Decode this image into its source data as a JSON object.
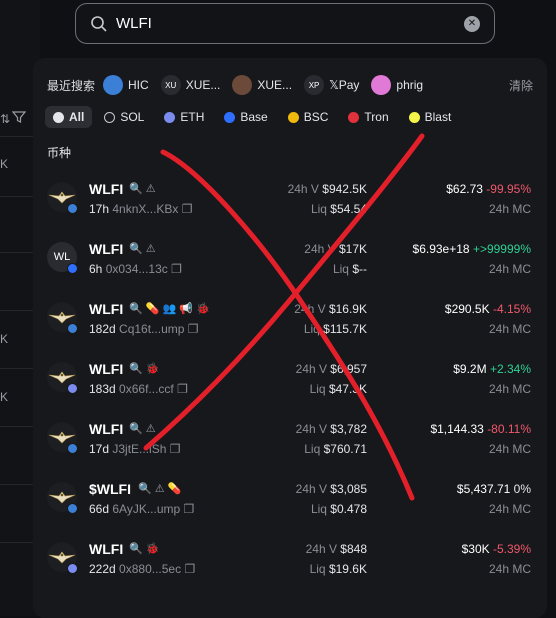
{
  "search": {
    "value": "WLFI",
    "placeholder": ""
  },
  "bg_left": {
    "k_labels": [
      "K",
      "K",
      "K"
    ]
  },
  "recent": {
    "label": "最近搜索",
    "clear_label": "清除",
    "items": [
      {
        "label": "HIC",
        "avatar_text": "",
        "color": "#3b7fd6"
      },
      {
        "label": "XUE...",
        "avatar_text": "XU",
        "color": "#2a2b31"
      },
      {
        "label": "XUE...",
        "avatar_text": "",
        "color": "#6b4a3a"
      },
      {
        "label": "𝕏Pay",
        "avatar_text": "XP",
        "color": "#2a2b31"
      },
      {
        "label": "phrig",
        "avatar_text": "",
        "color": "#e07ad6"
      }
    ]
  },
  "chains": [
    {
      "label": "All",
      "color": "#e6e6ea",
      "active": true
    },
    {
      "label": "SOL",
      "color": "#1a1b20",
      "active": false
    },
    {
      "label": "ETH",
      "color": "#7b8cf0",
      "active": false
    },
    {
      "label": "Base",
      "color": "#2f6fff",
      "active": false
    },
    {
      "label": "BSC",
      "color": "#f0b90b",
      "active": false
    },
    {
      "label": "Tron",
      "color": "#e0313c",
      "active": false
    },
    {
      "label": "Blast",
      "color": "#f3f34a",
      "active": false
    }
  ],
  "section_title": "币种",
  "tokens": [
    {
      "name": "WLFI",
      "logo": "eagle",
      "logo_text": "",
      "chain_color": "#3b7fd6",
      "icons": "🔍 ⚠",
      "age": "17h",
      "addr": "4nknX...KBx",
      "v_label": "24h V",
      "volume": "$942.5K",
      "liq_label": "Liq",
      "liq": "$54.54",
      "price": "$62.73",
      "change": "-99.95%",
      "change_kind": "neg",
      "mc_label": "24h MC"
    },
    {
      "name": "WLFI",
      "logo": "wl",
      "logo_text": "WL",
      "chain_color": "#2f6fff",
      "icons": "🔍 ⚠",
      "age": "6h",
      "addr": "0x034...13c",
      "v_label": "24h V",
      "volume": "$17K",
      "liq_label": "Liq",
      "liq": "$--",
      "price": "$6.93e+18",
      "change": "+>99999%",
      "change_kind": "pos",
      "mc_label": "24h MC"
    },
    {
      "name": "WLFI",
      "logo": "eagle",
      "logo_text": "",
      "chain_color": "#3b7fd6",
      "icons": "🔍 💊 👥 📢 🐞",
      "age": "182d",
      "addr": "Cq16t...ump",
      "v_label": "24h V",
      "volume": "$16.9K",
      "liq_label": "Liq",
      "liq": "$115.7K",
      "price": "$290.5K",
      "change": "-4.15%",
      "change_kind": "neg",
      "mc_label": "24h MC"
    },
    {
      "name": "WLFI",
      "logo": "eagle",
      "logo_text": "",
      "chain_color": "#7b8cf0",
      "icons": "🔍 🐞",
      "age": "183d",
      "addr": "0x66f...ccf",
      "v_label": "24h V",
      "volume": "$6,957",
      "liq_label": "Liq",
      "liq": "$47.3K",
      "price": "$9.2M",
      "change": "+2.34%",
      "change_kind": "pos",
      "mc_label": "24h MC"
    },
    {
      "name": "WLFI",
      "logo": "eagle",
      "logo_text": "",
      "chain_color": "#3b7fd6",
      "icons": "🔍 ⚠",
      "age": "17d",
      "addr": "J3jtE...iSh",
      "v_label": "24h V",
      "volume": "$3,782",
      "liq_label": "Liq",
      "liq": "$760.71",
      "price": "$1,144.33",
      "change": "-80.11%",
      "change_kind": "neg",
      "mc_label": "24h MC"
    },
    {
      "name": "$WLFI",
      "logo": "eagle",
      "logo_text": "",
      "chain_color": "#3b7fd6",
      "icons": "🔍 ⚠ 💊",
      "age": "66d",
      "addr": "6AyJK...ump",
      "v_label": "24h V",
      "volume": "$3,085",
      "liq_label": "Liq",
      "liq": "$0.478",
      "price": "$5,437.71",
      "change": "0%",
      "change_kind": "zero",
      "mc_label": "24h MC"
    },
    {
      "name": "WLFI",
      "logo": "eagle",
      "logo_text": "",
      "chain_color": "#7b8cf0",
      "icons": "🔍 🐞",
      "age": "222d",
      "addr": "0x880...5ec",
      "v_label": "24h V",
      "volume": "$848",
      "liq_label": "Liq",
      "liq": "$19.6K",
      "price": "$30K",
      "change": "-5.39%",
      "change_kind": "neg",
      "mc_label": "24h MC"
    }
  ]
}
